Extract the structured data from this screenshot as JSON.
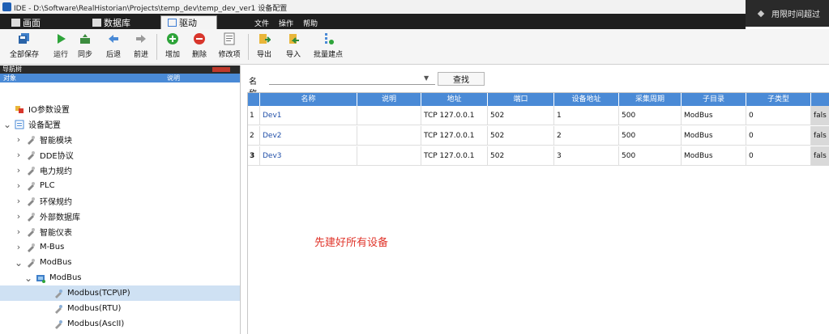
{
  "window": {
    "title": "IDE - D:\\Software\\RealHistorian\\Projects\\temp_dev\\temp_dev_ver1  设备配置",
    "trial_banner": "用限时间超过"
  },
  "tabs": [
    {
      "label": "画面",
      "icon": "screen-icon",
      "active": false
    },
    {
      "label": "数据库",
      "icon": "database-icon",
      "active": false
    },
    {
      "label": "驱动",
      "icon": "driver-icon",
      "active": true
    }
  ],
  "menu": [
    "文件",
    "操作",
    "帮助"
  ],
  "toolbar": {
    "items": [
      {
        "label": "全部保存",
        "icon": "save-all-icon"
      },
      {
        "label": "运行",
        "icon": "run-icon"
      },
      {
        "label": "同步",
        "icon": "sync-icon"
      },
      {
        "label": "后退",
        "icon": "back-icon"
      },
      {
        "label": "前进",
        "icon": "forward-icon"
      },
      {
        "label": "增加",
        "icon": "add-icon"
      },
      {
        "label": "删除",
        "icon": "delete-icon"
      },
      {
        "label": "修改项",
        "icon": "edit-icon"
      },
      {
        "label": "导出",
        "icon": "export-icon"
      },
      {
        "label": "导入",
        "icon": "import-icon"
      },
      {
        "label": "批量建点",
        "icon": "batch-create-icon"
      }
    ]
  },
  "nav": {
    "title": "导航树",
    "col_object": "对象",
    "col_desc": "说明",
    "items": [
      {
        "label": "IO参数设置",
        "level": 0,
        "expand": "",
        "icon": "io-params-icon"
      },
      {
        "label": "设备配置",
        "level": 0,
        "expand": "down",
        "icon": "device-config-icon"
      },
      {
        "label": "智能模块",
        "level": 1,
        "expand": "right",
        "icon": "plugin-icon"
      },
      {
        "label": "DDE协议",
        "level": 1,
        "expand": "right",
        "icon": "plugin-icon"
      },
      {
        "label": "电力规约",
        "level": 1,
        "expand": "right",
        "icon": "plugin-icon"
      },
      {
        "label": "PLC",
        "level": 1,
        "expand": "right",
        "icon": "plugin-icon"
      },
      {
        "label": "环保规约",
        "level": 1,
        "expand": "right",
        "icon": "plugin-icon"
      },
      {
        "label": "外部数据库",
        "level": 1,
        "expand": "right",
        "icon": "plugin-icon"
      },
      {
        "label": "智能仪表",
        "level": 1,
        "expand": "right",
        "icon": "plugin-icon"
      },
      {
        "label": "M-Bus",
        "level": 1,
        "expand": "right",
        "icon": "plugin-icon"
      },
      {
        "label": "ModBus",
        "level": 1,
        "expand": "down",
        "icon": "plugin-icon"
      },
      {
        "label": "ModBus",
        "level": 2,
        "expand": "down",
        "icon": "modbus-device-icon"
      },
      {
        "label": "Modbus(TCP\\IP)",
        "level": 3,
        "expand": "",
        "icon": "protocol-icon",
        "selected": true
      },
      {
        "label": "Modbus(RTU)",
        "level": 3,
        "expand": "",
        "icon": "protocol-icon"
      },
      {
        "label": "Modbus(AscII)",
        "level": 3,
        "expand": "",
        "icon": "protocol-icon"
      }
    ]
  },
  "search": {
    "label": "名称",
    "value": "",
    "button": "查找"
  },
  "grid": {
    "columns": [
      "",
      "名称",
      "说明",
      "地址",
      "端口",
      "设备地址",
      "采集周期",
      "子目录",
      "子类型",
      ""
    ],
    "rows": [
      {
        "no": "1",
        "cells": [
          "Dev1",
          "",
          "TCP 127.0.0.1",
          "502",
          "1",
          "500",
          "ModBus",
          "0",
          "fals"
        ]
      },
      {
        "no": "2",
        "cells": [
          "Dev2",
          "",
          "TCP 127.0.0.1",
          "502",
          "2",
          "500",
          "ModBus",
          "0",
          "fals"
        ]
      },
      {
        "no": "3",
        "cells": [
          "Dev3",
          "",
          "TCP 127.0.0.1",
          "502",
          "3",
          "500",
          "ModBus",
          "0",
          "fals"
        ],
        "current": true
      }
    ]
  },
  "annotation": "先建好所有设备",
  "colors": {
    "header_blue": "#4a8ad6",
    "dark_bar": "#1f1f1f",
    "selection": "#cfe1f3",
    "annotation_red": "#e0352b",
    "link_blue": "#1f4ea8"
  }
}
